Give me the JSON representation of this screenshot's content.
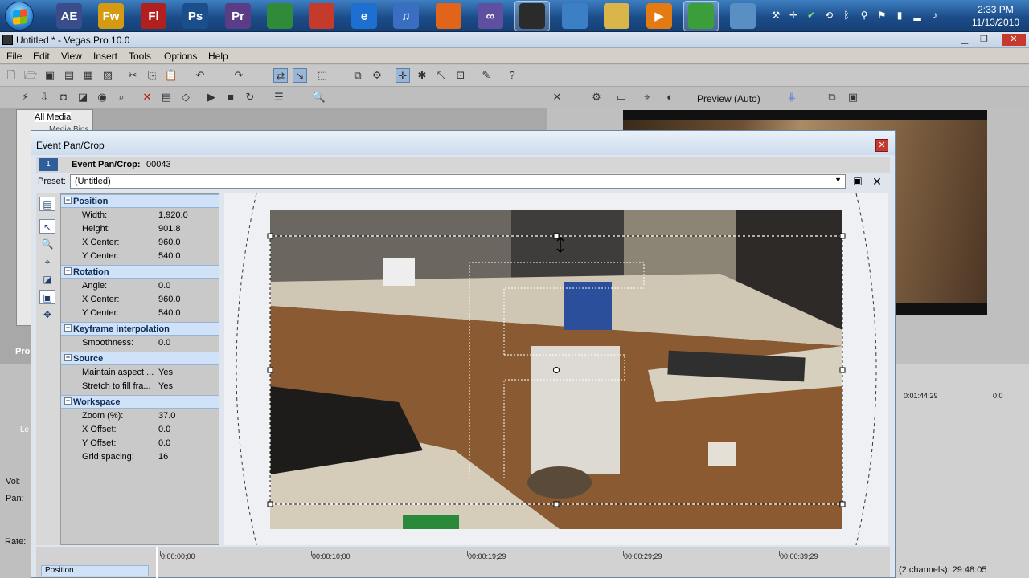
{
  "taskbar": {
    "icons": [
      {
        "name": "after-effects-icon",
        "label": "AE",
        "color": "#3a4c8a"
      },
      {
        "name": "fireworks-icon",
        "label": "Fw",
        "color": "#d49a12"
      },
      {
        "name": "flash-icon",
        "label": "Fl",
        "color": "#b21f1f"
      },
      {
        "name": "photoshop-icon",
        "label": "Ps",
        "color": "#1a4f8c"
      },
      {
        "name": "premiere-icon",
        "label": "Pr",
        "color": "#5b3c86"
      },
      {
        "name": "chrome-icon",
        "label": "",
        "color": "#2f8a3a"
      },
      {
        "name": "ccleaner-icon",
        "label": "",
        "color": "#c43b2b"
      },
      {
        "name": "internet-explorer-icon",
        "label": "e",
        "color": "#1d6fd0"
      },
      {
        "name": "itunes-icon",
        "label": "♫",
        "color": "#3a6ec0"
      },
      {
        "name": "firefox-icon",
        "label": "",
        "color": "#e0651a"
      },
      {
        "name": "infinity-icon",
        "label": "∞",
        "color": "#5e4fa0"
      },
      {
        "name": "vegas-icon",
        "label": "",
        "color": "#2b2b2b"
      },
      {
        "name": "dvd-architect-icon",
        "label": "",
        "color": "#3b7fc4"
      },
      {
        "name": "folder-icon",
        "label": "",
        "color": "#d8b64a"
      },
      {
        "name": "media-player-icon",
        "label": "▶",
        "color": "#e37a12"
      },
      {
        "name": "messenger-icon",
        "label": "",
        "color": "#3c9e3a"
      },
      {
        "name": "explorer-icon",
        "label": "",
        "color": "#5a8fc4"
      }
    ],
    "clock_time": "2:33 PM",
    "clock_date": "11/13/2010"
  },
  "window": {
    "title": "Untitled * - Vegas Pro 10.0"
  },
  "menu": [
    "File",
    "Edit",
    "View",
    "Insert",
    "Tools",
    "Options",
    "Help"
  ],
  "media": {
    "all_media": "All Media",
    "media_bins": "Media Bins"
  },
  "preview": {
    "mode_label": "Preview (Auto)"
  },
  "side_labels": {
    "project": "Pro",
    "vol": "Vol:",
    "pan": "Pan:",
    "rate": "Rate:",
    "track_label": "Le"
  },
  "right_panel": {
    "time_right": "0:01:44;29",
    "time_right2": "0:0",
    "status": "(2 channels): 29:48:05"
  },
  "dialog": {
    "title": "Event Pan/Crop",
    "event_number": "1",
    "event_label": "Event Pan/Crop:",
    "event_id": "00043",
    "preset_label": "Preset:",
    "preset_value": "(Untitled)",
    "close_glyph": "✕",
    "sections": [
      {
        "name": "Position",
        "rows": [
          {
            "k": "Width:",
            "v": "1,920.0"
          },
          {
            "k": "Height:",
            "v": "901.8"
          },
          {
            "k": "X Center:",
            "v": "960.0"
          },
          {
            "k": "Y Center:",
            "v": "540.0"
          }
        ]
      },
      {
        "name": "Rotation",
        "rows": [
          {
            "k": "Angle:",
            "v": "0.0"
          },
          {
            "k": "X Center:",
            "v": "960.0"
          },
          {
            "k": "Y Center:",
            "v": "540.0"
          }
        ]
      },
      {
        "name": "Keyframe interpolation",
        "rows": [
          {
            "k": "Smoothness:",
            "v": "0.0"
          }
        ]
      },
      {
        "name": "Source",
        "rows": [
          {
            "k": "Maintain aspect ...",
            "v": "Yes"
          },
          {
            "k": "Stretch to fill fra...",
            "v": "Yes"
          }
        ]
      },
      {
        "name": "Workspace",
        "rows": [
          {
            "k": "Zoom (%):",
            "v": "37.0"
          },
          {
            "k": "X Offset:",
            "v": "0.0"
          },
          {
            "k": "Y Offset:",
            "v": "0.0"
          },
          {
            "k": "Grid spacing:",
            "v": "16"
          }
        ]
      }
    ],
    "timeline": {
      "track_label": "Position",
      "ticks": [
        "0:00:00;00",
        "00:00:10;00",
        "00:00:19;29",
        "00:00:29;29",
        "00:00:39;29"
      ]
    }
  }
}
